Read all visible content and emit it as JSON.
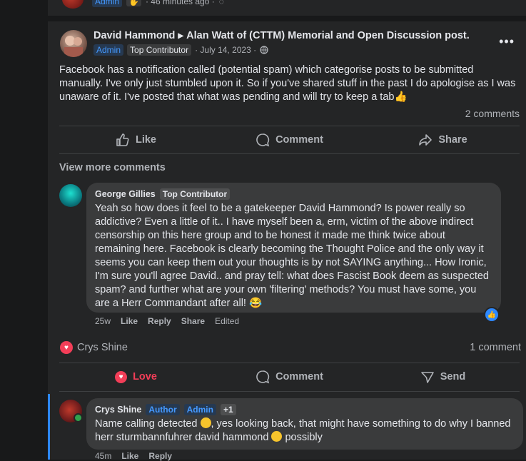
{
  "top_card": {
    "badge_admin": "Admin",
    "time": "· 46 minutes ago ·"
  },
  "post": {
    "author": "David Hammond",
    "group": "Alan Watt of (CTTM) Memorial and Open Discussion post.",
    "badge_admin": "Admin",
    "badge_contributor": "Top Contributor",
    "date": "· July 14, 2023 ·",
    "body": "Facebook has a notification called (potential spam) which categorise posts to be submitted manually. I've only just stumbled upon it. So if you've shared stuff in the past I do apologise as I was unaware of it. I've posted that what was pending and will try to keep a tab👍",
    "comment_count": "2 comments",
    "actions": {
      "like": "Like",
      "comment": "Comment",
      "share": "Share"
    },
    "view_more": "View more comments"
  },
  "comment1": {
    "author": "George Gillies",
    "badge": "Top Contributor",
    "text": "Yeah so how does it feel to be a gatekeeper David Hammond? Is power really so addictive? Even a little of it.. I have myself been a, erm, victim of the above indirect censorship on this here group and to be honest it made me think twice about remaining here. Facebook is clearly becoming the Thought Police and the only way it seems you can keep them out your thoughts is by not SAYING anything... How Ironic, I'm sure you'll agree David.. and pray tell: what does Fascist Book deem as suspected spam? and further what are your own 'filtering' methods? You must have some, you are a Herr Commandant after all! 😂",
    "time": "25w",
    "like": "Like",
    "reply": "Reply",
    "share": "Share",
    "edited": "Edited"
  },
  "post2": {
    "reactor": "Crys Shine",
    "comment_count": "1 comment",
    "actions": {
      "love": "Love",
      "comment": "Comment",
      "send": "Send"
    }
  },
  "comment2": {
    "author": "Crys Shine",
    "badge_author": "Author",
    "badge_admin": "Admin",
    "badge_plus": "+1",
    "text_a": "Name calling detected ",
    "text_b": ", yes looking back, that might have something to do why I banned herr sturmbannfuhrer david hammond ",
    "text_c": " possibly",
    "time": "45m",
    "like": "Like",
    "reply": "Reply"
  },
  "colors": {
    "background": "#18191a",
    "card": "#242526",
    "bubble": "#3a3b3c",
    "accent_blue": "#2d88ff",
    "love_red": "#f33e58",
    "text_secondary": "#b0b3b8"
  }
}
